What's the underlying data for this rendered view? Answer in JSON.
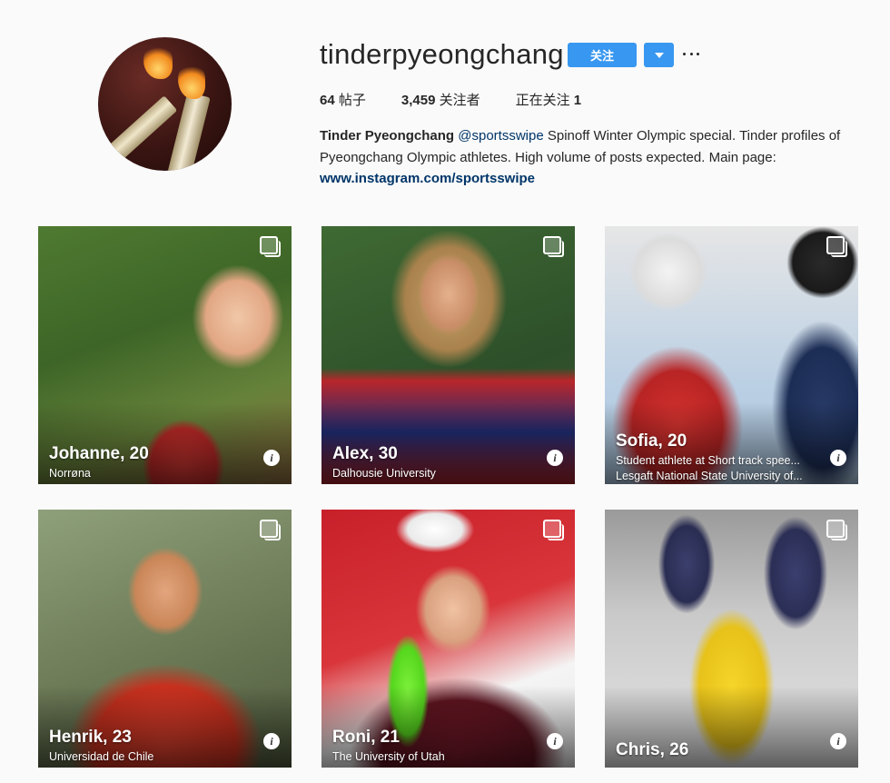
{
  "profile": {
    "username": "tinderpyeongchang",
    "follow_label": "关注",
    "stats": {
      "posts_value": "64",
      "posts_label": "帖子",
      "followers_value": "3,459",
      "followers_label": "关注者",
      "following_label": "正在关注",
      "following_value": "1"
    },
    "bio": {
      "name": "Tinder Pyeongchang",
      "mention": "@sportsswipe",
      "text": " Spinoff Winter Olympic special. Tinder profiles of Pyeongchang Olympic athletes. High volume of posts expected. Main page:",
      "link": "www.instagram.com/sportsswipe"
    }
  },
  "posts": [
    {
      "name": "Johanne, 20",
      "sub1": "Norrøna",
      "sub2": ""
    },
    {
      "name": "Alex, 30",
      "sub1": "Dalhousie University",
      "sub2": ""
    },
    {
      "name": "Sofia, 20",
      "sub1": "Student athlete at Short track spee...",
      "sub2": "Lesgaft National State University of..."
    },
    {
      "name": "Henrik, 23",
      "sub1": "Universidad de Chile",
      "sub2": ""
    },
    {
      "name": "Roni, 21",
      "sub1": "The University of Utah",
      "sub2": ""
    },
    {
      "name": "Chris, 26",
      "sub1": "",
      "sub2": ""
    }
  ],
  "icons": {
    "info": "i",
    "multi": "multi-image-icon",
    "dropdown": "caret-down-icon",
    "more": "more-icon"
  },
  "colors": {
    "accent": "#3897f0",
    "link": "#003569",
    "background": "#fafafa"
  }
}
